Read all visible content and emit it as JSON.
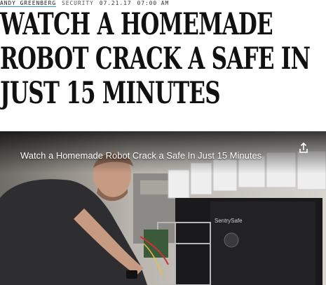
{
  "article": {
    "author": "ANDY GREENBERG",
    "section": "SECURITY",
    "date": "07.21.17",
    "time": "07:00 AM",
    "headline": "WATCH A HOMEMADE ROBOT CRACK A SAFE IN JUST 15 MINUTES"
  },
  "video": {
    "title": "Watch a Homemade Robot Crack a Safe In Just 15 Minutes",
    "share_icon": "share-icon",
    "safe_brand": "SentrySafe"
  },
  "colors": {
    "link_underline": "#2e9fd6",
    "headline": "#111111",
    "video_bg": "#2b2a28"
  }
}
